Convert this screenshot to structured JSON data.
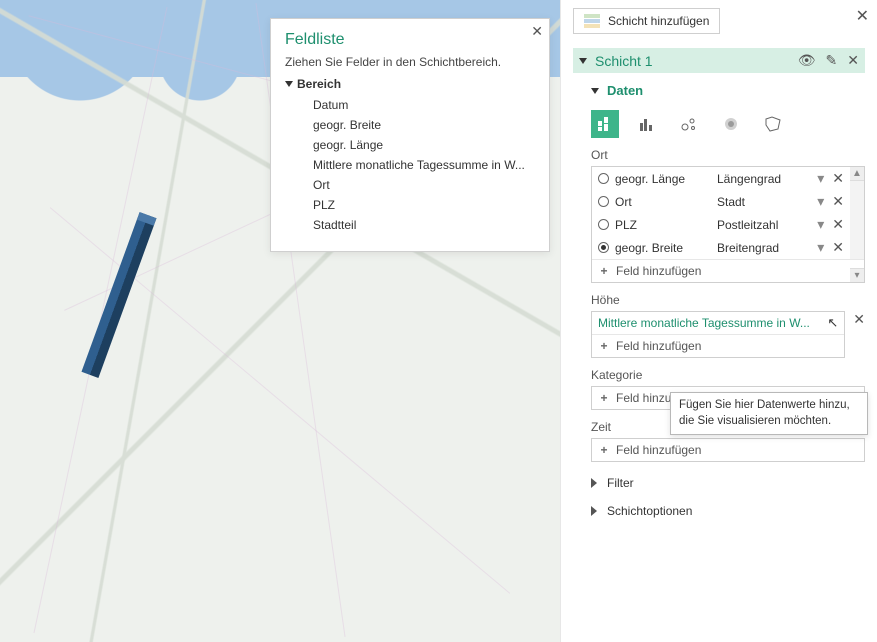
{
  "fieldlist": {
    "title": "Feldliste",
    "subtitle": "Ziehen Sie Felder in den Schichtbereich.",
    "root": "Bereich",
    "items": [
      "Datum",
      "geogr. Breite",
      "geogr. Länge",
      "Mittlere monatliche Tagessumme in W...",
      "Ort",
      "PLZ",
      "Stadtteil"
    ]
  },
  "panel": {
    "add_layer": "Schicht hinzufügen",
    "layer_name": "Schicht 1",
    "data_label": "Daten",
    "sections": {
      "ort": "Ort",
      "hoehe": "Höhe",
      "kategorie": "Kategorie",
      "zeit": "Zeit"
    },
    "ort_rows": [
      {
        "field": "geogr. Länge",
        "type": "Längengrad",
        "selected": false
      },
      {
        "field": "Ort",
        "type": "Stadt",
        "selected": false
      },
      {
        "field": "PLZ",
        "type": "Postleitzahl",
        "selected": false
      },
      {
        "field": "geogr. Breite",
        "type": "Breitengrad",
        "selected": true
      }
    ],
    "add_field": "Feld hinzufügen",
    "height_value": "Mittlere monatliche Tagessumme in W...",
    "tooltip": "Fügen Sie hier Datenwerte hinzu, die Sie visualisieren möchten.",
    "filter": "Filter",
    "layer_options": "Schichtoptionen"
  }
}
